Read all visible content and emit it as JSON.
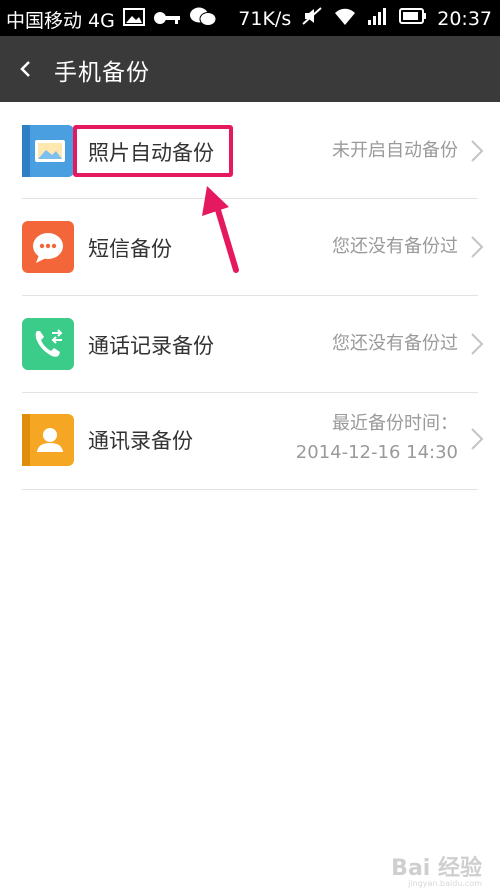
{
  "status_bar": {
    "carrier": "中国移动 4G",
    "net_speed": "71K/s",
    "time": "20:37"
  },
  "header": {
    "title": "手机备份",
    "back_icon": "chevron-left-icon"
  },
  "items": [
    {
      "title": "照片自动备份",
      "status": "未开启自动备份",
      "status_line2": "",
      "icon": "photo-icon",
      "icon_color": "#4a9fe0"
    },
    {
      "title": "短信备份",
      "status": "您还没有备份过",
      "status_line2": "",
      "icon": "chat-bubble-icon",
      "icon_color": "#f2663a"
    },
    {
      "title": "通话记录备份",
      "status": "您还没有备份过",
      "status_line2": "",
      "icon": "phone-icon",
      "icon_color": "#3ccc8a"
    },
    {
      "title": "通讯录备份",
      "status": "最近备份时间：",
      "status_line2": "2014-12-16 14:30",
      "icon": "contact-icon",
      "icon_color": "#f5a623"
    }
  ],
  "annotation": {
    "color": "#e5195f"
  },
  "watermark": {
    "brand": "Bai 经验",
    "url": "jingyan.baidu.com"
  }
}
